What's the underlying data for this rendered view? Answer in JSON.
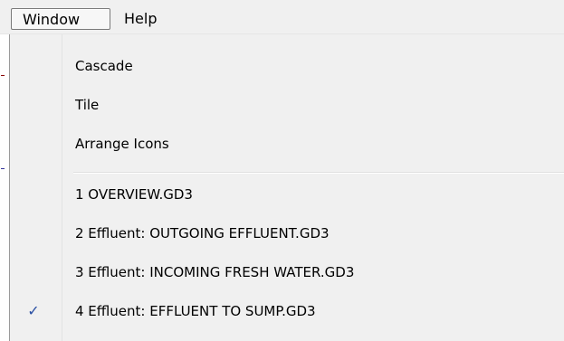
{
  "menubar": {
    "items": [
      {
        "label": "Window"
      },
      {
        "label": "Help"
      }
    ]
  },
  "dropdown": {
    "items": [
      {
        "label": "Cascade"
      },
      {
        "label": "Tile"
      },
      {
        "label": "Arrange Icons"
      },
      {
        "label": "1 OVERVIEW.GD3"
      },
      {
        "label": "2 Effluent: OUTGOING EFFLUENT.GD3"
      },
      {
        "label": "3 Effluent: INCOMING FRESH WATER.GD3"
      },
      {
        "label": "4 Effluent: EFFLUENT TO SUMP.GD3",
        "checked": true
      }
    ],
    "check_glyph": "✓",
    "check_color": "#2a4fa3"
  }
}
